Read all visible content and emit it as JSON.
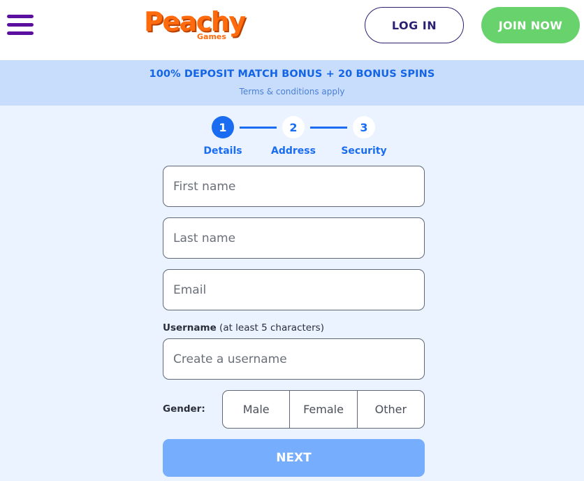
{
  "header": {
    "logo_text": "Peachy",
    "logo_subtext": "Games",
    "login_label": "LOG IN",
    "join_label": "JOIN NOW",
    "menu_icon": "hamburger-menu-icon"
  },
  "promo": {
    "title": "100% DEPOSIT MATCH BONUS + 20 BONUS SPINS",
    "terms": "Terms & conditions apply"
  },
  "stepper": {
    "steps": [
      {
        "number": "1",
        "label": "Details",
        "active": true
      },
      {
        "number": "2",
        "label": "Address",
        "active": false
      },
      {
        "number": "3",
        "label": "Security",
        "active": false
      }
    ]
  },
  "form": {
    "first_name_placeholder": "First name",
    "last_name_placeholder": "Last name",
    "email_placeholder": "Email",
    "username_label": "Username",
    "username_hint": " (at least 5 characters)",
    "username_placeholder": "Create a username",
    "gender_label": "Gender:",
    "gender_options": [
      "Male",
      "Female",
      "Other"
    ],
    "next_label": "NEXT"
  },
  "colors": {
    "accent_blue": "#1a6cf0",
    "brand_orange": "#ff6a0d",
    "join_green": "#68d36c",
    "menu_purple": "#5b0f9e",
    "next_button": "#76adfc"
  }
}
